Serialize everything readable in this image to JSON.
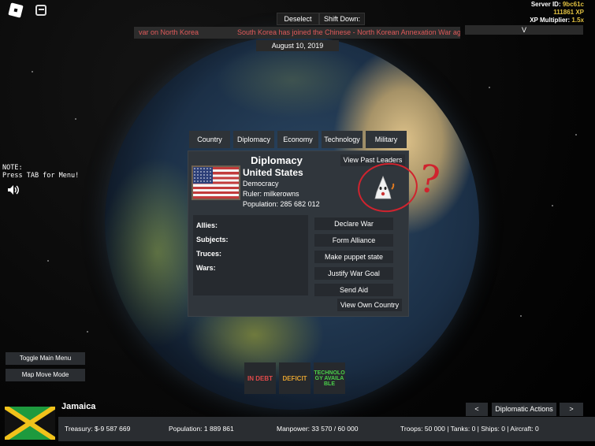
{
  "top": {
    "deselect_label": "Deselect",
    "shift_down_label": "Shift Down: Off",
    "ticker_left": "var on North Korea",
    "ticker_right": "South Korea has joined the Chinese - North Korean Annexation War agai",
    "date": "August 10, 2019",
    "v_label": "V"
  },
  "server": {
    "id_key": "Server ID:",
    "id_value": "9bc61c",
    "xp_total": "111861 XP",
    "xp_mult_key": "XP Multiplier:",
    "xp_mult_value": "1.5x"
  },
  "note": {
    "line1": "NOTE:",
    "line2": "Press TAB for Menu!"
  },
  "tabs": [
    "Country",
    "Diplomacy",
    "Economy",
    "Technology",
    "Military"
  ],
  "panel": {
    "title": "Diplomacy",
    "past_leaders": "View Past Leaders",
    "country": "United States",
    "government": "Democracy",
    "ruler": "Ruler: milkerowns",
    "population": "Population: 285 682 012",
    "relations": [
      "Allies:",
      "Subjects:",
      "Truces:",
      "Wars:"
    ],
    "actions": [
      "Declare War",
      "Form Alliance",
      "Make puppet state",
      "Justify War Goal",
      "Send Aid"
    ],
    "view_own": "View Own Country"
  },
  "annotation": {
    "mark": "?",
    "color": "#d0232e"
  },
  "status": {
    "debt": "IN DEBT",
    "deficit": "DEFICIT",
    "tech": "TECHNOLOGY AVAILABLE",
    "debt_color": "#e04a4a",
    "deficit_color": "#e0a030",
    "tech_color": "#4ad04a"
  },
  "left_buttons": [
    "Toggle Main Menu",
    "Map Move Mode"
  ],
  "bottom": {
    "country_name": "Jamaica",
    "treasury": "Treasury:  $-9 587 669",
    "population": "Population: 1 889 861",
    "manpower": "Manpower:  33 570  /  60 000",
    "military": "Troops: 50 000  |  Tanks: 0  |  Ships: 0  |  Aircraft: 0",
    "prev": "<",
    "diplomatic_actions": "Diplomatic Actions",
    "next": ">"
  },
  "icons": {
    "roblox": "roblox-logo-icon",
    "chat": "chat-icon",
    "speaker": "speaker-icon",
    "flag_usa": "usa-flag-icon",
    "flag_jamaica": "jamaica-flag-icon",
    "leader": "leader-avatar-icon"
  }
}
